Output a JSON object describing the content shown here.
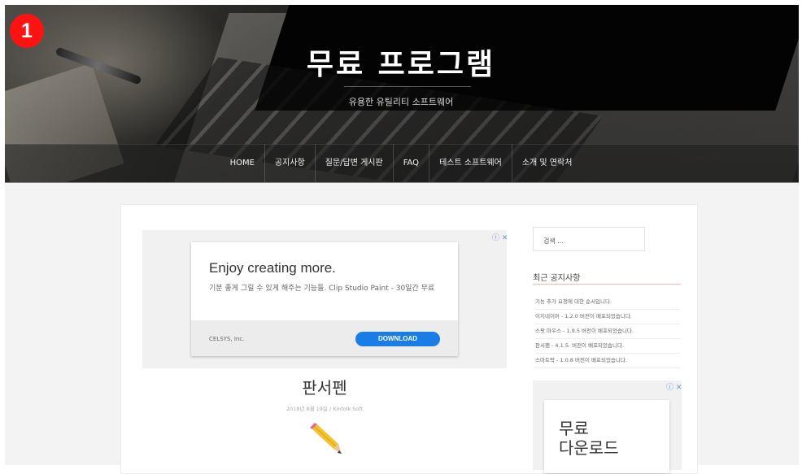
{
  "badge": "1",
  "site": {
    "title": "무료 프로그램",
    "tagline": "유용한 유틸리티 소프트웨어"
  },
  "nav": {
    "items": [
      "HOME",
      "공지사항",
      "질문/답변 게시판",
      "FAQ",
      "테스트 소프트웨어",
      "소개 및 연락처"
    ]
  },
  "ad": {
    "headline": "Enjoy creating more.",
    "text": "기분 좋게 그릴 수 있게 해주는 기능들. Clip Studio Paint - 30일간 무료",
    "advertiser": "CELSYS, Inc.",
    "button": "DOWNLOAD",
    "close_mark": "ⓘ ✕"
  },
  "post": {
    "title": "판서펜",
    "meta": "2018년 8월 19일 /  Kinfolk Soft"
  },
  "sidebar": {
    "search_placeholder": "검색 ...",
    "recent_title": "최근 공지사항",
    "notices": [
      "기능 추가 요청에 대한 순서입니다.",
      "이지네이머 - 1.2.0 버전이 배포되었습니다.",
      "스팟 마우스 - 1.9.5 버전이 배포되었습니다.",
      "판서펜 - 4.1.5. 버전이 배포되었습니다.",
      "스마트락 - 1.0.8 버전이 배포되었습니다."
    ],
    "ad_close_mark": "ⓘ ✕",
    "ad_line1": "무료",
    "ad_line2": "다운로드"
  },
  "colors": {
    "badge": "#ff1212",
    "button": "#1a7ce6",
    "widget_rule": "#f2b9a6"
  }
}
